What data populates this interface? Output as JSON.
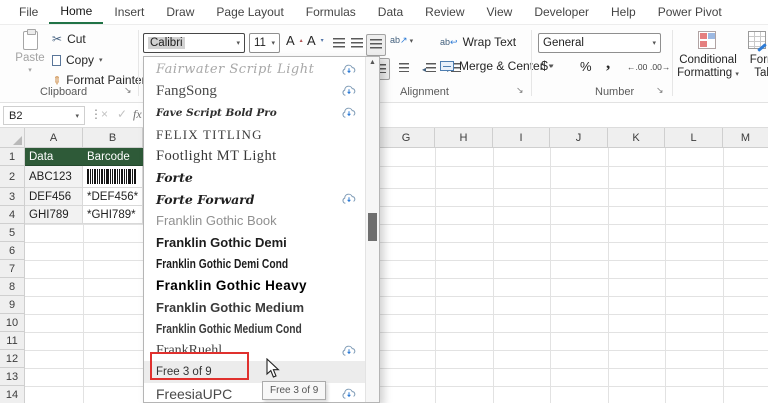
{
  "accent_color": "#217346",
  "ribbon": {
    "tabs": [
      {
        "label": "File"
      },
      {
        "label": "Home",
        "active": true
      },
      {
        "label": "Insert"
      },
      {
        "label": "Draw"
      },
      {
        "label": "Page Layout"
      },
      {
        "label": "Formulas"
      },
      {
        "label": "Data"
      },
      {
        "label": "Review"
      },
      {
        "label": "View"
      },
      {
        "label": "Developer"
      },
      {
        "label": "Help"
      },
      {
        "label": "Power Pivot"
      }
    ],
    "clipboard": {
      "group_label": "Clipboard",
      "paste_label": "Paste",
      "cut_label": "Cut",
      "copy_label": "Copy",
      "format_painter_label": "Format Painter"
    },
    "font_group": {
      "font_name_value": "Calibri",
      "font_size_value": "11"
    },
    "alignment_group": {
      "group_label": "Alignment",
      "wrap_text_label": "Wrap Text",
      "merge_center_label": "Merge & Center"
    },
    "number_group": {
      "group_label": "Number",
      "format_value": "General",
      "currency_label": "$",
      "percent_label": "%",
      "comma_label": ",",
      "increase_decimal_label": "←.00",
      "decrease_decimal_label": ".00→"
    },
    "styles_group": {
      "conditional_formatting_label": "Conditional Formatting",
      "format_table_line1": "Format",
      "format_table_line2": "Table"
    }
  },
  "formula_bar": {
    "name_box_value": "B2",
    "fx_label": "fx"
  },
  "grid": {
    "column_letters": [
      "A",
      "B",
      "G",
      "H",
      "I",
      "J",
      "K",
      "L",
      "M"
    ],
    "row_numbers": [
      "1",
      "2",
      "3",
      "4",
      "5",
      "6",
      "7",
      "8",
      "9",
      "10",
      "11",
      "12",
      "13",
      "14"
    ],
    "header_fill_color": "#2e5a38",
    "cells": {
      "a1": "Data",
      "b1": "Barcode",
      "a2": "ABC123",
      "b2_rendered_as": "barcode glyphs",
      "a3": "DEF456",
      "b3": "*DEF456*",
      "a4": "GHI789",
      "b4": "*GHI789*"
    }
  },
  "font_dropdown": {
    "items": [
      {
        "name": "Fairwater Script Light",
        "cloud": true,
        "look": "script-light"
      },
      {
        "name": "FangSong",
        "cloud": true,
        "look": "fangsong"
      },
      {
        "name": "Fave Script Bold Pro",
        "cloud": true,
        "look": "script-small"
      },
      {
        "name": "FELIX TITLING",
        "cloud": false,
        "look": "titling"
      },
      {
        "name": "Footlight MT Light",
        "cloud": false,
        "look": "serif-light"
      },
      {
        "name": "Forte",
        "cloud": false,
        "look": "script-bold"
      },
      {
        "name": "Forte Forward",
        "cloud": true,
        "look": "script-bold"
      },
      {
        "name": "Franklin Gothic Book",
        "cloud": false,
        "look": "sans-gray"
      },
      {
        "name": "Franklin Gothic Demi",
        "cloud": false,
        "look": "sans-demi"
      },
      {
        "name": "Franklin Gothic Demi Cond",
        "cloud": false,
        "look": "sans-demi-cond"
      },
      {
        "name": "Franklin Gothic Heavy",
        "cloud": false,
        "look": "sans-heavy"
      },
      {
        "name": "Franklin Gothic Medium",
        "cloud": false,
        "look": "sans-medium"
      },
      {
        "name": "Franklin Gothic Medium Cond",
        "cloud": false,
        "look": "sans-medium-cond"
      },
      {
        "name": "FrankRuehl",
        "cloud": true,
        "look": "serif"
      },
      {
        "name": "Free 3 of 9",
        "cloud": false,
        "look": "plain",
        "highlighted": true
      },
      {
        "name": "FreesiaUPC",
        "cloud": true,
        "look": "sans"
      }
    ]
  },
  "tooltip": {
    "text": "Free 3 of 9"
  },
  "annotation": {
    "highlight_color": "#e0312e"
  }
}
